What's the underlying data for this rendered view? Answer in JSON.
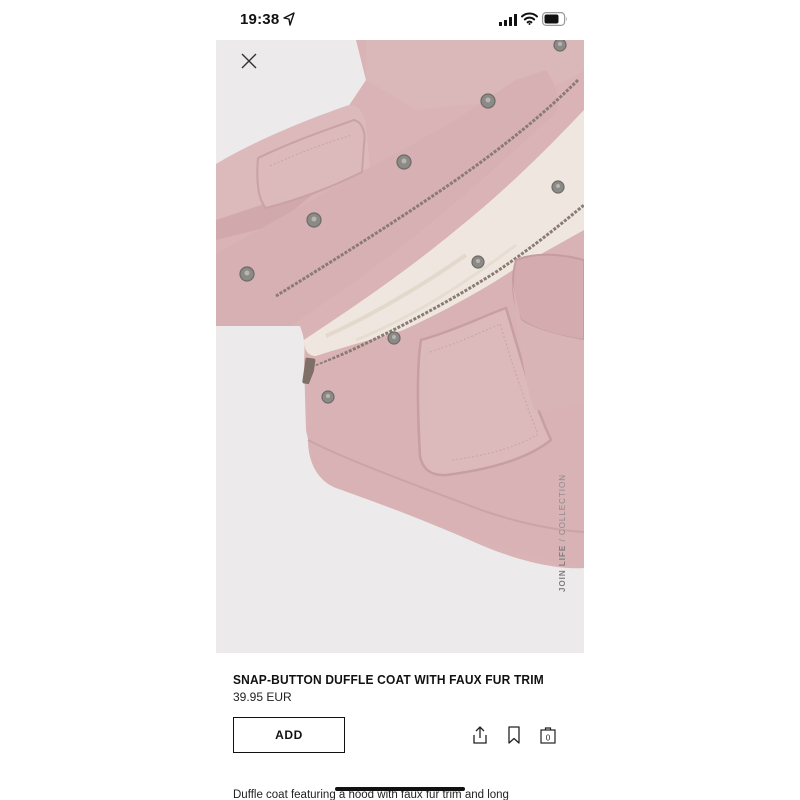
{
  "status_bar": {
    "time": "19:38",
    "icons": [
      "location-arrow-icon",
      "signal-bars-icon",
      "wifi-icon",
      "battery-icon"
    ]
  },
  "product": {
    "image_label_bold": "JOIN LIFE",
    "image_label_rest": " / COLLECTION",
    "title": "SNAP-BUTTON DUFFLE COAT WITH FAUX FUR TRIM",
    "price": "39.95 EUR",
    "add_label": "ADD",
    "description": "Duffle coat featuring a hood with faux fur trim and long"
  },
  "actions": [
    "share-icon",
    "bookmark-icon",
    "basket-icon"
  ],
  "basket_count": "0",
  "colors": {
    "coat_pink": "#d9b3b5",
    "coat_shadow": "#c79ea1",
    "lining": "#efe7df",
    "background": "#eceaea",
    "snap_metal": "#8c8a86"
  }
}
